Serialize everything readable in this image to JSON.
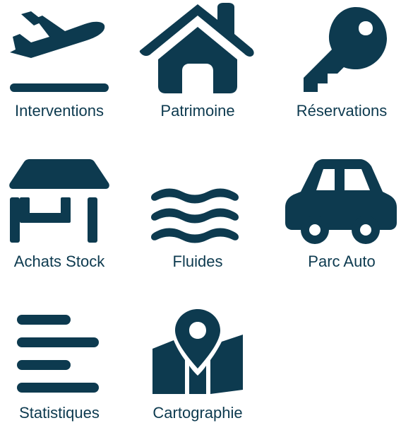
{
  "accent_color": "#0d3a4f",
  "background_color": "#ffffff",
  "tiles": [
    {
      "label": "Interventions",
      "icon": "plane-departure-icon"
    },
    {
      "label": "Patrimoine",
      "icon": "house-icon"
    },
    {
      "label": "Réservations",
      "icon": "key-icon"
    },
    {
      "label": "Achats Stock",
      "icon": "market-stall-icon"
    },
    {
      "label": "Fluides",
      "icon": "water-waves-icon"
    },
    {
      "label": "Parc Auto",
      "icon": "car-icon"
    },
    {
      "label": "Statistiques",
      "icon": "align-left-icon"
    },
    {
      "label": "Cartographie",
      "icon": "map-location-icon"
    }
  ]
}
